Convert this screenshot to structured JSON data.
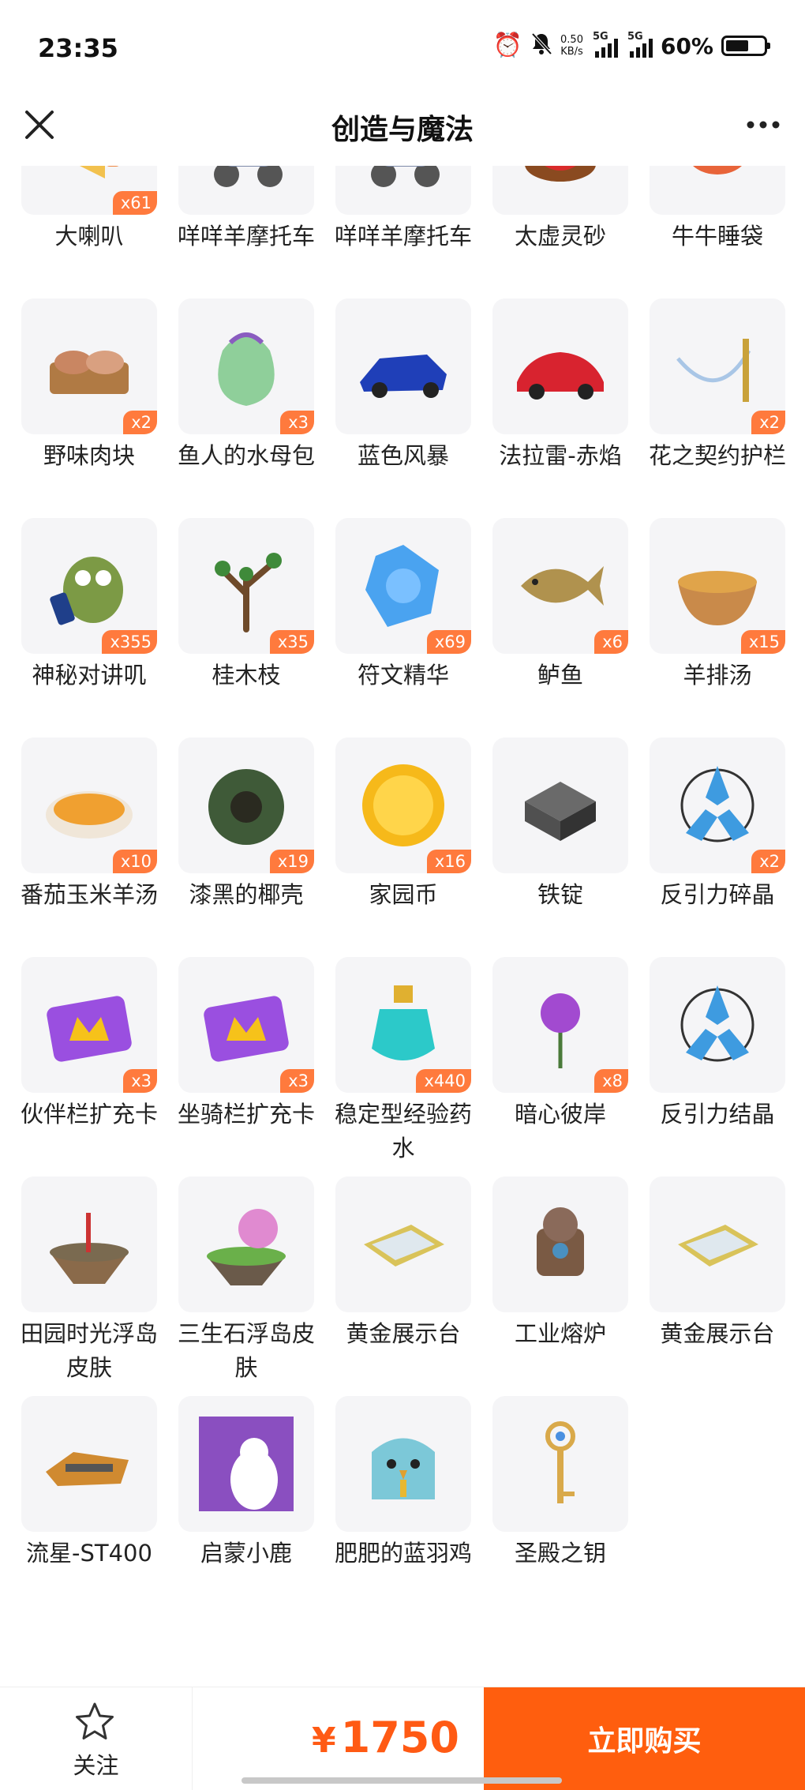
{
  "status_bar": {
    "time": "23:35",
    "net_speed_value": "0.50",
    "net_speed_unit": "KB/s",
    "signal_1": "5G",
    "signal_2": "5G",
    "battery": "60%",
    "battery_level": 0.6
  },
  "header": {
    "title": "创造与魔法",
    "more_label": "•••",
    "close_label": "✕"
  },
  "items": [
    {
      "name": "大喇叭",
      "count": "x61",
      "icon": "megaphone-icon",
      "color": "#f2c14e"
    },
    {
      "name": "咩咩羊摩托车",
      "count": "",
      "icon": "sheep-scooter-icon",
      "color": "#7d8aa8"
    },
    {
      "name": "咩咩羊摩托车",
      "count": "",
      "icon": "sheep-scooter-icon",
      "color": "#7d8aa8"
    },
    {
      "name": "太虚灵砂",
      "count": "",
      "icon": "red-orb-icon",
      "color": "#d92b2b"
    },
    {
      "name": "牛牛睡袋",
      "count": "",
      "icon": "cow-sleeping-bag-icon",
      "color": "#e8643a"
    },
    {
      "name": "野味肉块",
      "count": "x2",
      "icon": "meat-icon",
      "color": "#c98662"
    },
    {
      "name": "鱼人的水母包",
      "count": "x3",
      "icon": "jellyfish-bag-icon",
      "color": "#8fcf9a"
    },
    {
      "name": "蓝色风暴",
      "count": "",
      "icon": "blue-racecar-icon",
      "color": "#1f3fb8"
    },
    {
      "name": "法拉雷-赤焰",
      "count": "",
      "icon": "red-car-icon",
      "color": "#d8232f"
    },
    {
      "name": "花之契约护栏",
      "count": "x2",
      "icon": "flower-fence-icon",
      "color": "#a9c6e6"
    },
    {
      "name": "神秘对讲叽",
      "count": "x355",
      "icon": "walkie-talkie-bird-icon",
      "color": "#7c9a45"
    },
    {
      "name": "桂木枝",
      "count": "x35",
      "icon": "branch-icon",
      "color": "#6e4a2a"
    },
    {
      "name": "符文精华",
      "count": "x69",
      "icon": "rune-crystal-icon",
      "color": "#4aa3f0"
    },
    {
      "name": "鲈鱼",
      "count": "x6",
      "icon": "fish-icon",
      "color": "#b0924e"
    },
    {
      "name": "羊排汤",
      "count": "x15",
      "icon": "soup-bowl-icon",
      "color": "#e0a44a"
    },
    {
      "name": "番茄玉米羊汤",
      "count": "x10",
      "icon": "tomato-soup-icon",
      "color": "#f0a030"
    },
    {
      "name": "漆黑的椰壳",
      "count": "x19",
      "icon": "coconut-shell-icon",
      "color": "#3f5a38"
    },
    {
      "name": "家园币",
      "count": "x16",
      "icon": "gold-coin-icon",
      "color": "#f6b91a"
    },
    {
      "name": "铁锭",
      "count": "",
      "icon": "iron-ingot-icon",
      "color": "#505050"
    },
    {
      "name": "反引力碎晶",
      "count": "x2",
      "icon": "antigravity-shard-icon",
      "color": "#3e9be0"
    },
    {
      "name": "伙伴栏扩充卡",
      "count": "x3",
      "icon": "partner-card-icon",
      "color": "#9a4fe0"
    },
    {
      "name": "坐骑栏扩充卡",
      "count": "x3",
      "icon": "mount-card-icon",
      "color": "#9a4fe0"
    },
    {
      "name": "稳定型经验药水",
      "count": "x440",
      "icon": "potion-icon",
      "color": "#2cc9c9"
    },
    {
      "name": "暗心彼岸",
      "count": "x8",
      "icon": "spider-lily-icon",
      "color": "#a24ad0"
    },
    {
      "name": "反引力结晶",
      "count": "",
      "icon": "antigravity-crystal-icon",
      "color": "#3e9be0"
    },
    {
      "name": "田园时光浮岛皮肤",
      "count": "",
      "icon": "floating-island-icon",
      "color": "#7a6a50"
    },
    {
      "name": "三生石浮岛皮肤",
      "count": "",
      "icon": "sakura-island-icon",
      "color": "#e08ad0"
    },
    {
      "name": "黄金展示台",
      "count": "",
      "icon": "gold-display-stand-icon",
      "color": "#d9c35a"
    },
    {
      "name": "工业熔炉",
      "count": "",
      "icon": "industrial-furnace-icon",
      "color": "#7a5a44"
    },
    {
      "name": "黄金展示台",
      "count": "",
      "icon": "gold-display-stand-icon",
      "color": "#d9c35a"
    },
    {
      "name": "流星-ST400",
      "count": "",
      "icon": "hoverbike-icon",
      "color": "#d08a30"
    },
    {
      "name": "启蒙小鹿",
      "count": "",
      "icon": "deer-icon",
      "color": "#8a4fc0"
    },
    {
      "name": "肥肥的蓝羽鸡",
      "count": "",
      "icon": "blue-chicken-icon",
      "color": "#7cc8d8"
    },
    {
      "name": "圣殿之钥",
      "count": "",
      "icon": "temple-key-icon",
      "color": "#d9a94a"
    }
  ],
  "bottom": {
    "follow_label": "关注",
    "currency": "¥",
    "price": "1750",
    "buy_label": "立即购买"
  },
  "colors": {
    "accent": "#ff5e0e",
    "badge": "#ff7a3d",
    "tile_bg": "#f5f5f7"
  }
}
